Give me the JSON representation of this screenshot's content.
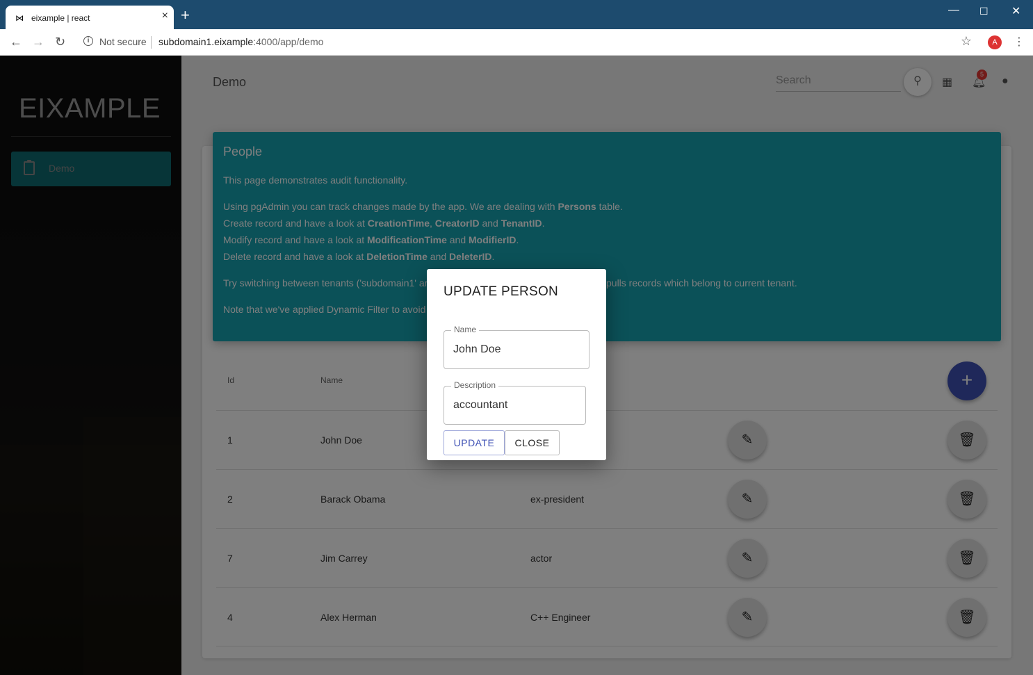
{
  "browser": {
    "tab_title": "eixample | react",
    "tab_icon": "bowtie-icon",
    "security": "Not secure",
    "url_host": "subdomain1.eixample",
    "url_rest": ":4000/app/demo",
    "profile_initial": "A"
  },
  "sidebar": {
    "logo": "EIXAMPLE",
    "items": [
      {
        "label": "Demo",
        "icon": "clipboard-icon",
        "active": true
      }
    ]
  },
  "header": {
    "title": "Demo",
    "search_placeholder": "Search",
    "notifications_count": "5"
  },
  "card": {
    "title": "People",
    "intro": "This page demonstrates audit functionality.",
    "p1_a": "Using pgAdmin you can track changes made by the app. We are dealing with ",
    "p1_b": "Persons",
    "p1_c": " table.",
    "p2_a": "Create record and have a look at ",
    "p2_b": "CreationTime",
    "p2_c": ", ",
    "p2_d": "CreatorID",
    "p2_e": " and ",
    "p2_f": "TenantID",
    "p2_g": ".",
    "p3_a": "Modify record and have a look at ",
    "p3_b": "ModificationTime",
    "p3_c": " and ",
    "p3_d": "ModifierID",
    "p3_e": ".",
    "p4_a": "Delete record and have a look at ",
    "p4_b": "DeletionTime",
    "p4_c": " and ",
    "p4_d": "DeleterID",
    "p4_e": ".",
    "p5_left": "Try switching between tenants ('subdomain1' ar",
    "p5_right": "pulls records which belong to current tenant.",
    "p6_left": "Note that we've applied Dynamic Filter to avoid p"
  },
  "table": {
    "headers": {
      "id": "Id",
      "name": "Name"
    },
    "rows": [
      {
        "id": "1",
        "name": "John Doe",
        "description": ""
      },
      {
        "id": "2",
        "name": "Barack Obama",
        "description": "ex-president"
      },
      {
        "id": "7",
        "name": "Jim Carrey",
        "description": "actor"
      },
      {
        "id": "4",
        "name": "Alex Herman",
        "description": "C++ Engineer"
      }
    ]
  },
  "dialog": {
    "title": "UPDATE PERSON",
    "name_label": "Name",
    "name_value": "John Doe",
    "description_label": "Description",
    "description_value": "accountant",
    "update_label": "UPDATE",
    "close_label": "CLOSE"
  },
  "colors": {
    "accent": "#16a2b1",
    "primary": "#3f51b5",
    "tabbar": "#1d4b6e"
  }
}
